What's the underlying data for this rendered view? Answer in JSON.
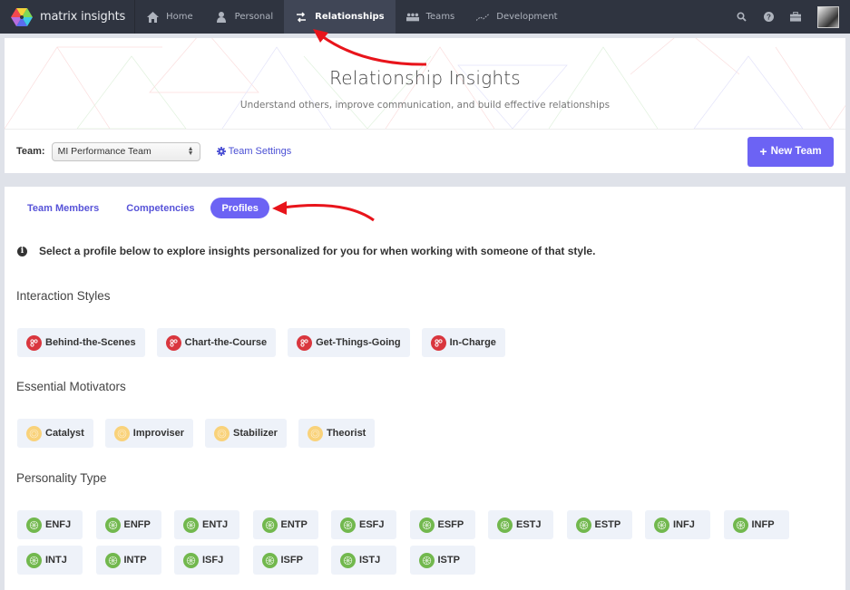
{
  "nav": {
    "brand": "matrix insights",
    "items": [
      {
        "label": "Home",
        "icon": "home-icon",
        "active": false
      },
      {
        "label": "Personal",
        "icon": "person-icon",
        "active": false
      },
      {
        "label": "Relationships",
        "icon": "exchange-icon",
        "active": true
      },
      {
        "label": "Teams",
        "icon": "group-icon",
        "active": false
      },
      {
        "label": "Development",
        "icon": "line-chart-icon",
        "active": false
      }
    ],
    "right_icons": [
      "search-icon",
      "help-icon",
      "toolbox-icon",
      "user-avatar"
    ]
  },
  "hero": {
    "title": "Relationship Insights",
    "subtitle": "Understand others, improve communication, and build effective relationships"
  },
  "teambar": {
    "team_label": "Team:",
    "team_selected": "MI Performance Team",
    "team_settings": "Team Settings",
    "new_team": "New Team"
  },
  "tabs": [
    {
      "label": "Team Members",
      "active": false
    },
    {
      "label": "Competencies",
      "active": false
    },
    {
      "label": "Profiles",
      "active": true
    }
  ],
  "info_text": "Select a profile below to explore insights personalized for you for when working with someone of that style.",
  "sections": {
    "interaction_styles": {
      "title": "Interaction Styles",
      "items": [
        "Behind-the-Scenes",
        "Chart-the-Course",
        "Get-Things-Going",
        "In-Charge"
      ]
    },
    "essential_motivators": {
      "title": "Essential Motivators",
      "items": [
        "Catalyst",
        "Improviser",
        "Stabilizer",
        "Theorist"
      ]
    },
    "personality_type": {
      "title": "Personality Type",
      "items": [
        "ENFJ",
        "ENFP",
        "ENTJ",
        "ENTP",
        "ESFJ",
        "ESFP",
        "ESTJ",
        "ESTP",
        "INFJ",
        "INFP",
        "INTJ",
        "INTP",
        "ISFJ",
        "ISFP",
        "ISTJ",
        "ISTP"
      ]
    }
  },
  "colors": {
    "nav_bg": "#2f3440",
    "accent": "#6c63f4",
    "link": "#4a4fd4",
    "interaction_icon": "#d9363e",
    "motivator_icon": "#f9d27a",
    "personality_icon": "#72b84e",
    "annotation_arrow": "#e8141b"
  }
}
